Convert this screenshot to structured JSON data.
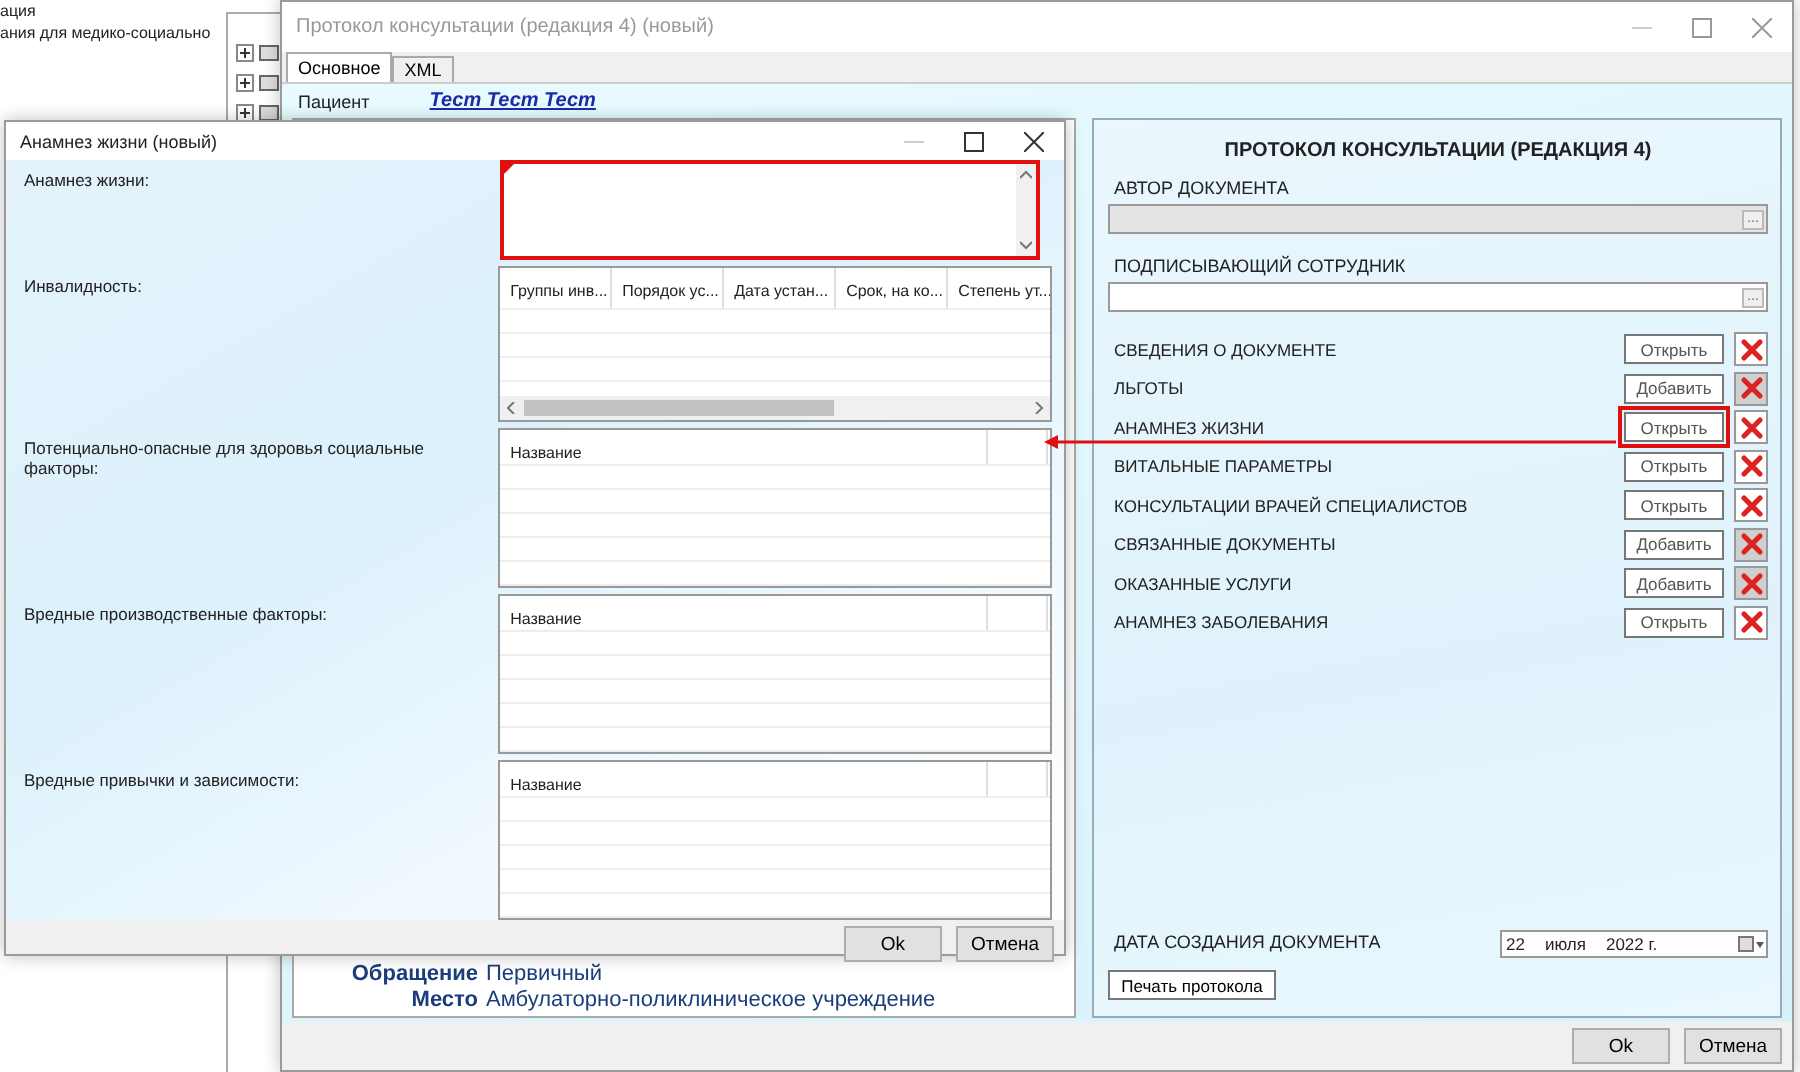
{
  "background_app": {
    "lines": [
      "ация",
      "ания для медико-социально"
    ],
    "tree_nodes": [
      {
        "expanded": false
      },
      {
        "expanded": false
      },
      {
        "expanded": false
      }
    ]
  },
  "main_window": {
    "title": "Протокол консультации (редакция 4) (новый)",
    "tabs": [
      {
        "label": "Основное",
        "selected": true
      },
      {
        "label": "XML",
        "selected": false
      }
    ],
    "patient_label": "Пациент",
    "patient_name": "Тест Тест Тест",
    "details": [
      {
        "label": "Обращение",
        "value": "Первичный"
      },
      {
        "label": "Место",
        "value": "Амбулаторно-поликлиническое учреждение"
      }
    ],
    "panel": {
      "title": "ПРОТОКОЛ КОНСУЛЬТАЦИИ (РЕДАКЦИЯ 4)",
      "author": {
        "label": "АВТОР ДОКУМЕНТА",
        "button": "...",
        "disabled": true
      },
      "signer": {
        "label": "ПОДПИСЫВАЮЩИЙ СОТРУДНИК",
        "button": "...",
        "disabled": false
      },
      "sections": [
        {
          "label": "СВЕДЕНИЯ О ДОКУМЕНТЕ",
          "button": "Открыть",
          "delete_disabled": false,
          "highlighted": false
        },
        {
          "label": "ЛЬГОТЫ",
          "button": "Добавить",
          "delete_disabled": true,
          "highlighted": false
        },
        {
          "label": "АНАМНЕЗ ЖИЗНИ",
          "button": "Открыть",
          "delete_disabled": false,
          "highlighted": true
        },
        {
          "label": "ВИТАЛЬНЫЕ ПАРАМЕТРЫ",
          "button": "Открыть",
          "delete_disabled": false,
          "highlighted": false
        },
        {
          "label": "КОНСУЛЬТАЦИИ ВРАЧЕЙ СПЕЦИАЛИСТОВ",
          "button": "Открыть",
          "delete_disabled": false,
          "highlighted": false
        },
        {
          "label": "СВЯЗАННЫЕ ДОКУМЕНТЫ",
          "button": "Добавить",
          "delete_disabled": true,
          "highlighted": false
        },
        {
          "label": "ОКАЗАННЫЕ УСЛУГИ",
          "button": "Добавить",
          "delete_disabled": true,
          "highlighted": false
        },
        {
          "label": "АНАМНЕЗ ЗАБОЛЕВАНИЯ",
          "button": "Открыть",
          "delete_disabled": false,
          "highlighted": false
        }
      ],
      "date_label": "ДАТА СОЗДАНИЯ ДОКУМЕНТА",
      "date": {
        "day": "22",
        "month": "июля",
        "year": "2022 г."
      },
      "print_button": "Печать протокола"
    },
    "buttons": [
      "Ok",
      "Отмена"
    ]
  },
  "dialog": {
    "title": "Анамнез жизни (новый)",
    "fields": [
      {
        "kind": "text",
        "label": "Анамнез жизни:",
        "highlighted": true
      },
      {
        "kind": "table",
        "label": "Инвалидность:",
        "columns": [
          "Группы инв...",
          "Порядок ус...",
          "Дата устан...",
          "Срок, на ко...",
          "Степень ут..."
        ],
        "scrollbar": true
      },
      {
        "kind": "table",
        "label": "Потенциально-опасные для здоровья социальные факторы:",
        "columns": [
          "Название"
        ],
        "scrollbar": false
      },
      {
        "kind": "table",
        "label": "Вредные производственные факторы:",
        "columns": [
          "Название"
        ],
        "scrollbar": false
      },
      {
        "kind": "table",
        "label": "Вредные привычки и зависимости:",
        "columns": [
          "Название"
        ],
        "scrollbar": false
      }
    ],
    "buttons": [
      "Ok",
      "Отмена"
    ]
  }
}
